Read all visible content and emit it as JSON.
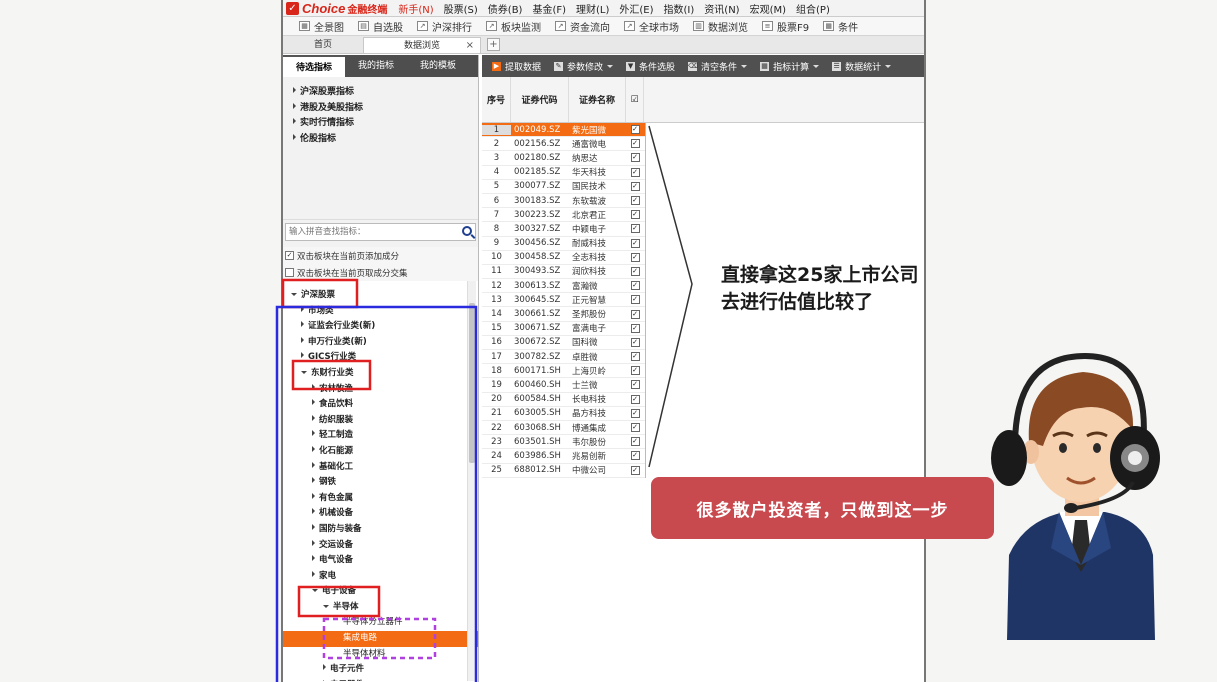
{
  "menubar": {
    "logo_text": "Choice",
    "logo_sub": "金融终端",
    "items": [
      "新手(N)",
      "股票(S)",
      "债券(B)",
      "基金(F)",
      "理财(L)",
      "外汇(E)",
      "指数(I)",
      "资讯(N)",
      "宏观(M)",
      "组合(P)"
    ]
  },
  "toolbar": {
    "items": [
      "全景图",
      "自选股",
      "沪深排行",
      "板块监测",
      "资金流向",
      "全球市场",
      "数据浏览",
      "股票F9",
      "条件"
    ]
  },
  "tabs": {
    "home": "首页",
    "active": "数据浏览",
    "close": "×",
    "add": "+"
  },
  "left": {
    "tabs": [
      "待选指标",
      "我的指标",
      "我的模板"
    ],
    "categories": [
      "沪深股票指标",
      "港股及美股指标",
      "实时行情指标",
      "伦股指标"
    ],
    "search_placeholder": "输入拼音查找指标：",
    "checkboxes": [
      {
        "label": "双击板块在当前页添加成分",
        "checked": true
      },
      {
        "label": "双击板块在当前页取成分交集",
        "checked": false
      }
    ],
    "tree": [
      {
        "label": "沪深股票",
        "level": 1,
        "expanded": true
      },
      {
        "label": "市场类",
        "level": 2,
        "expanded": false
      },
      {
        "label": "证监会行业类(新)",
        "level": 2,
        "expanded": false
      },
      {
        "label": "申万行业类(新)",
        "level": 2,
        "expanded": false
      },
      {
        "label": "GICS行业类",
        "level": 2,
        "expanded": false
      },
      {
        "label": "东财行业类",
        "level": 2,
        "expanded": true
      },
      {
        "label": "农林牧渔",
        "level": 3,
        "expanded": false
      },
      {
        "label": "食品饮料",
        "level": 3,
        "expanded": false
      },
      {
        "label": "纺织服装",
        "level": 3,
        "expanded": false
      },
      {
        "label": "轻工制造",
        "level": 3,
        "expanded": false
      },
      {
        "label": "化石能源",
        "level": 3,
        "expanded": false
      },
      {
        "label": "基础化工",
        "level": 3,
        "expanded": false
      },
      {
        "label": "钢铁",
        "level": 3,
        "expanded": false
      },
      {
        "label": "有色金属",
        "level": 3,
        "expanded": false
      },
      {
        "label": "机械设备",
        "level": 3,
        "expanded": false
      },
      {
        "label": "国防与装备",
        "level": 3,
        "expanded": false
      },
      {
        "label": "交运设备",
        "level": 3,
        "expanded": false
      },
      {
        "label": "电气设备",
        "level": 3,
        "expanded": false
      },
      {
        "label": "家电",
        "level": 3,
        "expanded": false
      },
      {
        "label": "电子设备",
        "level": 3,
        "expanded": true
      },
      {
        "label": "半导体",
        "level": 4,
        "expanded": true
      },
      {
        "label": "半导体分立器件",
        "level": 5
      },
      {
        "label": "集成电路",
        "level": 5,
        "selected": true
      },
      {
        "label": "半导体材料",
        "level": 5
      },
      {
        "label": "电子元件",
        "level": 4,
        "expanded": false
      },
      {
        "label": "电子器件",
        "level": 4,
        "expanded": false
      }
    ]
  },
  "right": {
    "actions": [
      {
        "label": "提取数据",
        "icon": "extract-icon",
        "dropdown": false
      },
      {
        "label": "参数修改",
        "icon": "pencil-icon",
        "dropdown": true
      },
      {
        "label": "条件选股",
        "icon": "filter-icon",
        "dropdown": false
      },
      {
        "label": "清空条件",
        "icon": "clear-icon",
        "dropdown": true
      },
      {
        "label": "指标计算",
        "icon": "calculator-icon",
        "dropdown": true
      },
      {
        "label": "数据统计",
        "icon": "list-icon",
        "dropdown": true
      }
    ],
    "columns": [
      "序号",
      "证券代码",
      "证券名称",
      "☑"
    ],
    "rows": [
      {
        "idx": "1",
        "code": "002049.SZ",
        "name": "紫光国微"
      },
      {
        "idx": "2",
        "code": "002156.SZ",
        "name": "通富微电"
      },
      {
        "idx": "3",
        "code": "002180.SZ",
        "name": "纳思达"
      },
      {
        "idx": "4",
        "code": "002185.SZ",
        "name": "华天科技"
      },
      {
        "idx": "5",
        "code": "300077.SZ",
        "name": "国民技术"
      },
      {
        "idx": "6",
        "code": "300183.SZ",
        "name": "东软载波"
      },
      {
        "idx": "7",
        "code": "300223.SZ",
        "name": "北京君正"
      },
      {
        "idx": "8",
        "code": "300327.SZ",
        "name": "中颖电子"
      },
      {
        "idx": "9",
        "code": "300456.SZ",
        "name": "耐威科技"
      },
      {
        "idx": "10",
        "code": "300458.SZ",
        "name": "全志科技"
      },
      {
        "idx": "11",
        "code": "300493.SZ",
        "name": "润欣科技"
      },
      {
        "idx": "12",
        "code": "300613.SZ",
        "name": "富瀚微"
      },
      {
        "idx": "13",
        "code": "300645.SZ",
        "name": "正元智慧"
      },
      {
        "idx": "14",
        "code": "300661.SZ",
        "name": "圣邦股份"
      },
      {
        "idx": "15",
        "code": "300671.SZ",
        "name": "富满电子"
      },
      {
        "idx": "16",
        "code": "300672.SZ",
        "name": "国科微"
      },
      {
        "idx": "17",
        "code": "300782.SZ",
        "name": "卓胜微"
      },
      {
        "idx": "18",
        "code": "600171.SH",
        "name": "上海贝岭"
      },
      {
        "idx": "19",
        "code": "600460.SH",
        "name": "士兰微"
      },
      {
        "idx": "20",
        "code": "600584.SH",
        "name": "长电科技"
      },
      {
        "idx": "21",
        "code": "603005.SH",
        "name": "晶方科技"
      },
      {
        "idx": "22",
        "code": "603068.SH",
        "name": "博通集成"
      },
      {
        "idx": "23",
        "code": "603501.SH",
        "name": "韦尔股份"
      },
      {
        "idx": "24",
        "code": "603986.SH",
        "name": "兆易创新"
      },
      {
        "idx": "25",
        "code": "688012.SH",
        "name": "中微公司"
      }
    ]
  },
  "overlay": {
    "line1": "直接拿这25家上市公司",
    "line2": "去进行估值比较了",
    "bubble": "很多散户投资者，只做到这一步"
  },
  "colors": {
    "accent_orange": "#f36b12",
    "brand_red": "#d8261a",
    "annot_red": "#e02020",
    "annot_blue": "#2a2adf",
    "annot_purple": "#b040e0",
    "bubble_red": "#c84a4f"
  }
}
